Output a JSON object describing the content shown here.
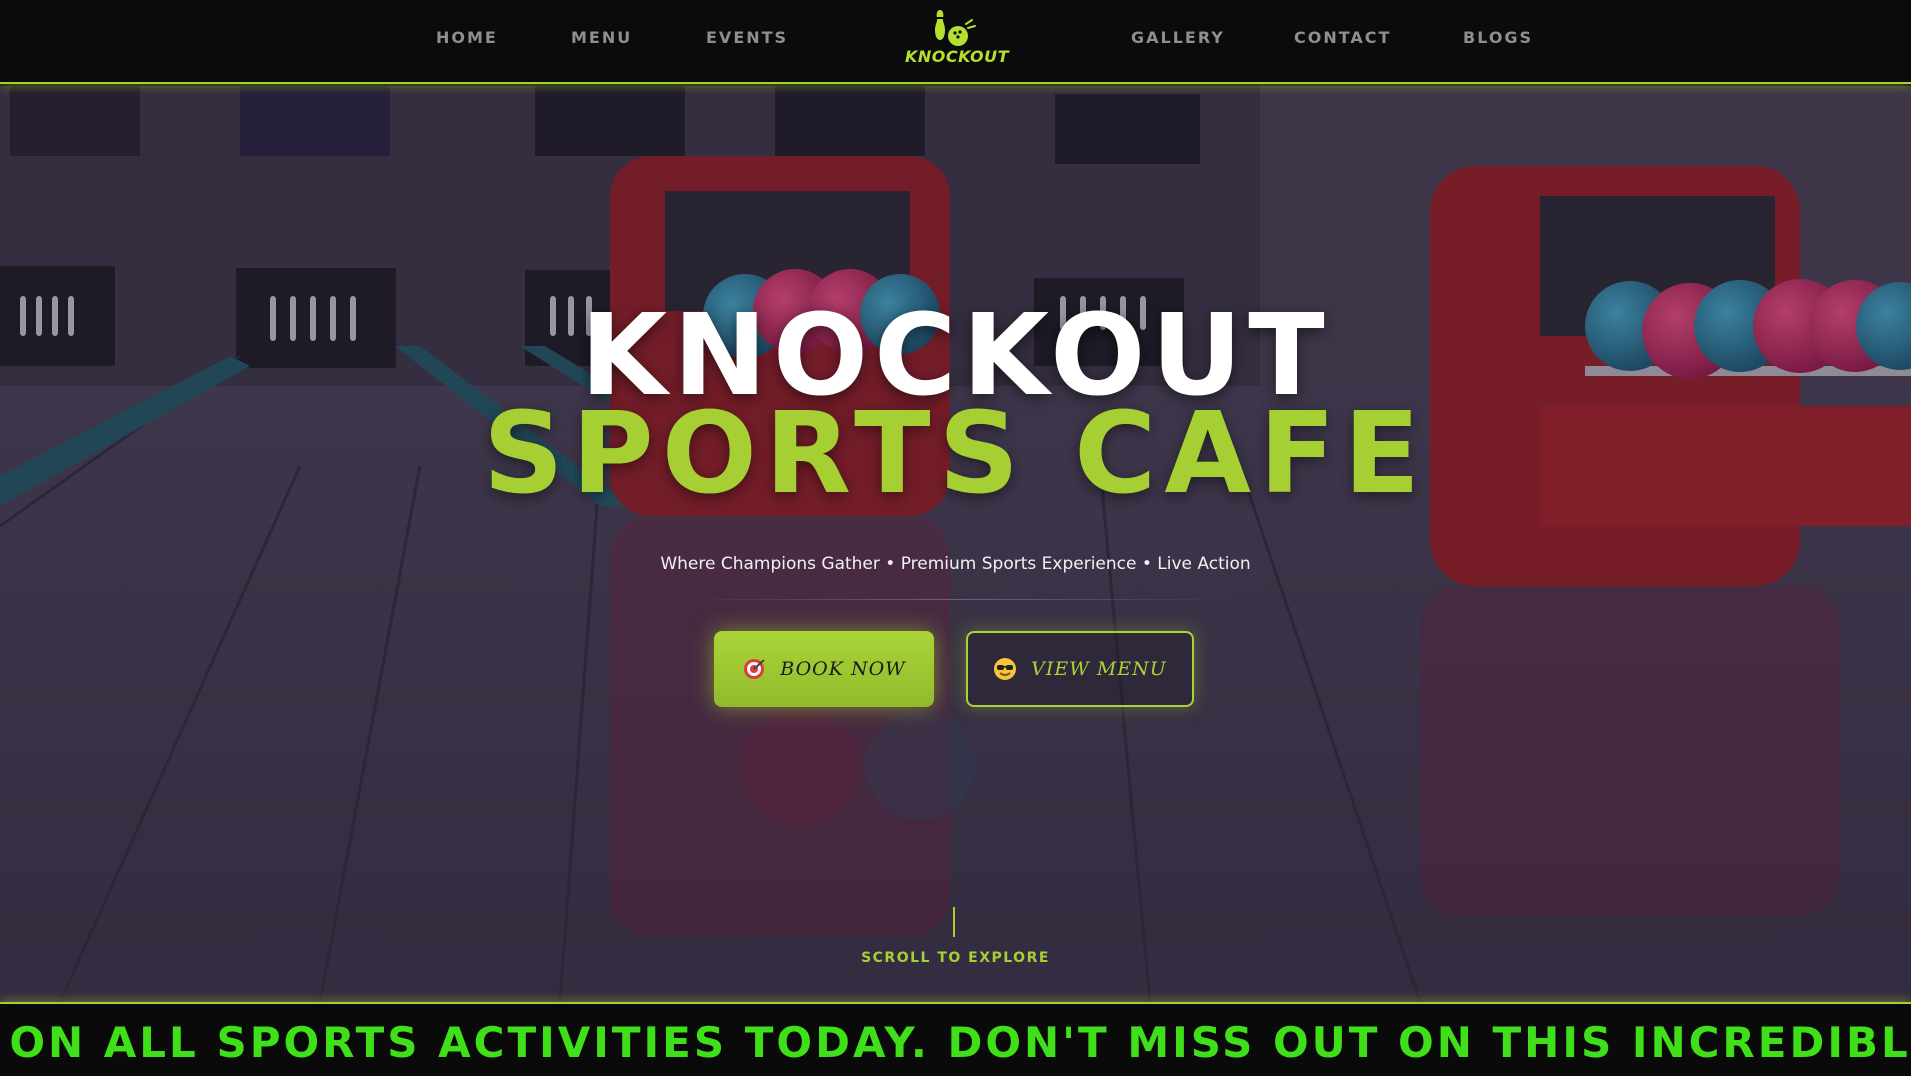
{
  "nav": {
    "left_links": [
      "HOME",
      "MENU",
      "EVENTS"
    ],
    "right_links": [
      "GALLERY",
      "CONTACT",
      "BLOGS"
    ],
    "logo_text": "KNOCKOUT",
    "accent_color": "#a4d12e"
  },
  "hero": {
    "title_line1": "KNOCKOUT",
    "title_line2": "SPORTS CAFE",
    "tagline": "Where Champions Gather • Premium Sports Experience • Live Action",
    "book_button": {
      "icon": "target-icon",
      "label": "BOOK NOW"
    },
    "menu_button": {
      "icon": "sunglasses-emoji-icon",
      "label": "VIEW MENU"
    },
    "scroll_label": "SCROLL TO EXPLORE",
    "background": "bowling-alley-image"
  },
  "ticker": {
    "text": "F ON ALL SPORTS ACTIVITIES TODAY. DON'T MISS OUT ON THIS INCREDIBLE OPP",
    "color": "#3fe01a"
  }
}
